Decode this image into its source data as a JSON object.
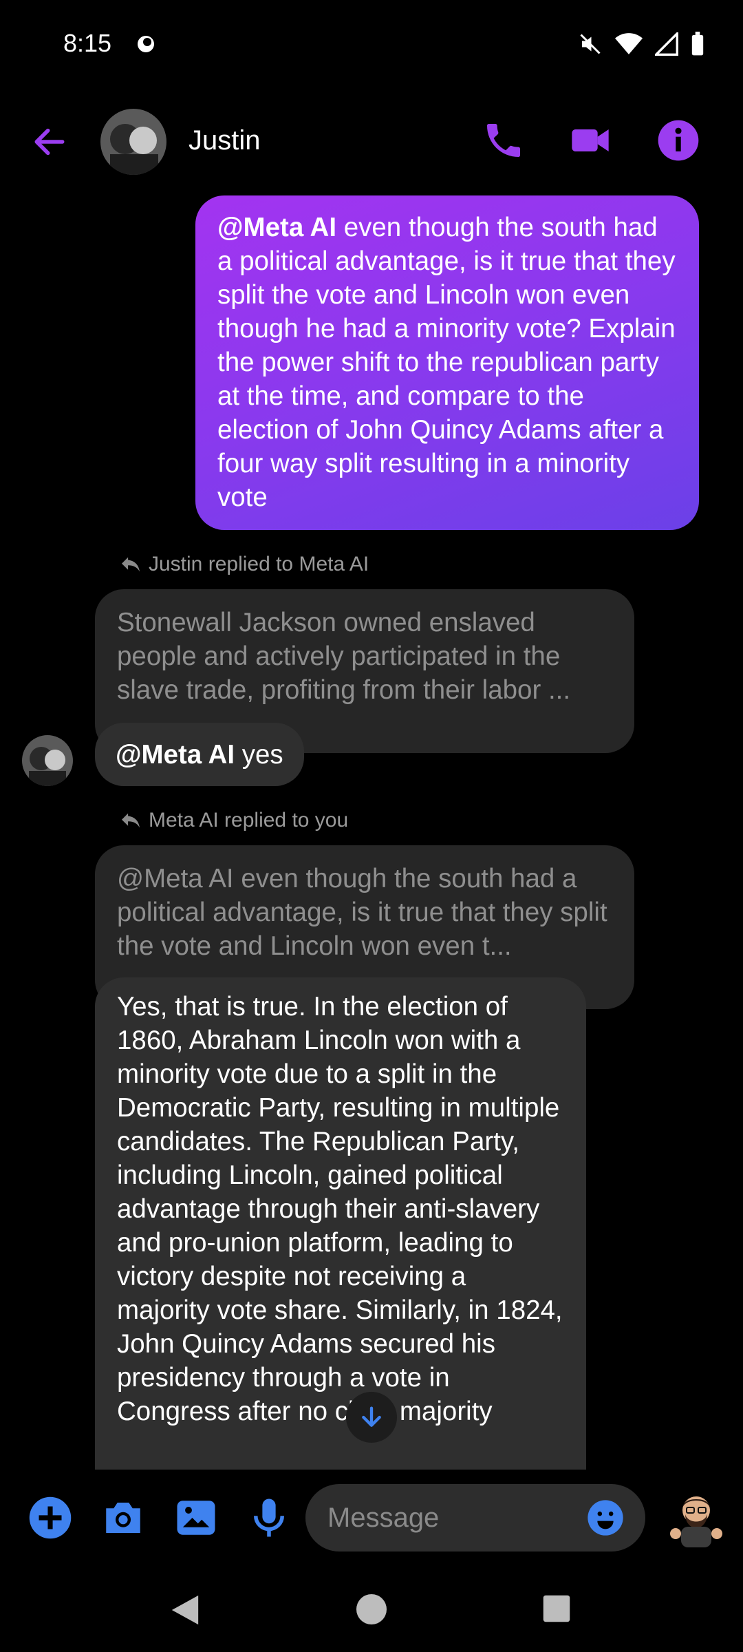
{
  "status_bar": {
    "time": "8:15"
  },
  "header": {
    "contact_name": "Justin"
  },
  "messages": {
    "outgoing_mention": "@Meta AI",
    "outgoing_text": " even though the south had a political advantage, is it true that they split the vote and Lincoln won even though he had a minority vote? Explain the power shift to the republican party at the time, and compare to the election of John Quincy Adams after a four way split resulting in a minority vote",
    "reply_note_1": "Justin replied to Meta AI",
    "quoted_1": "Stonewall Jackson owned enslaved people and actively participated in the slave trade, profiting from their labor ...",
    "incoming_1_mention": "@Meta AI",
    "incoming_1_text": " yes",
    "reply_note_2": "Meta AI replied to you",
    "quoted_2": "@Meta AI even though the south had a political advantage, is it true that they split the vote and Lincoln won even t...",
    "incoming_2_text": "Yes, that is true. In the election of 1860, Abraham Lincoln won with a minority vote due to a split in the Democratic Party, resulting in multiple candidates. The Republican Party, including Lincoln, gained political advantage through their anti-slavery and pro-union platform, leading to victory despite not receiving a majority vote share. Similarly, in 1824, John Quincy Adams secured his presidency through a vote in Congress after no clear majority"
  },
  "composer": {
    "placeholder": "Message"
  },
  "colors": {
    "accent_purple": "#9b3df0",
    "accent_blue": "#3f82ef"
  }
}
